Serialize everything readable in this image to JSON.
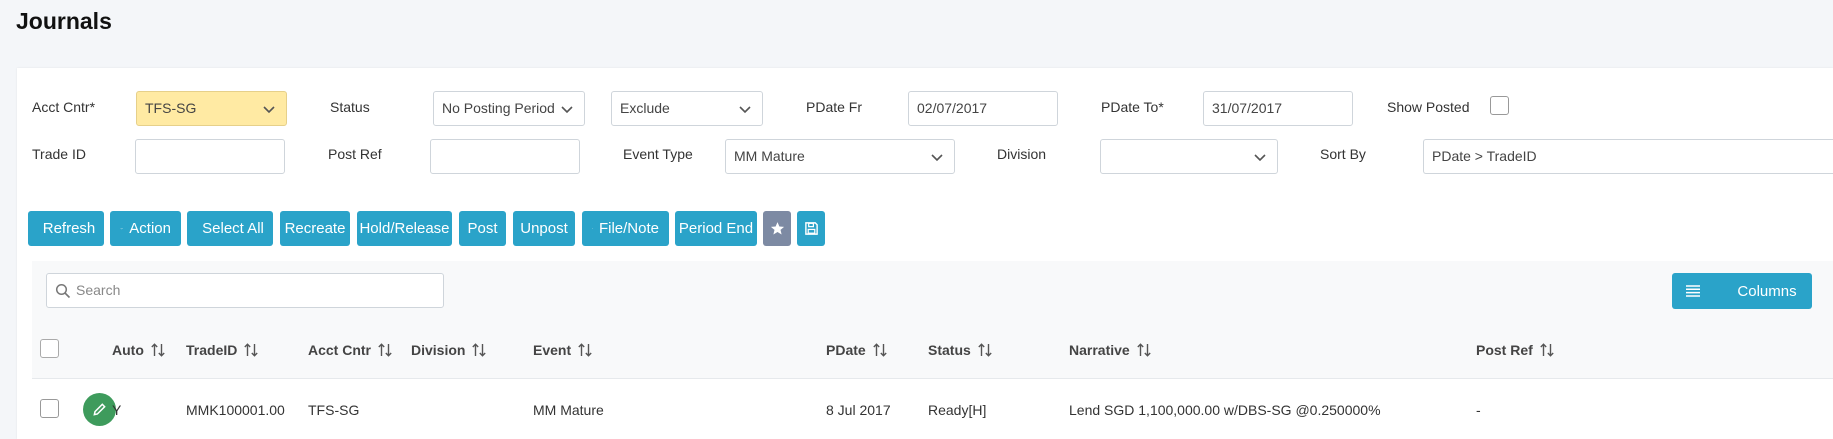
{
  "page": {
    "title": "Journals"
  },
  "filters": {
    "acct_cntr": {
      "label": "Acct Cntr*",
      "value": "TFS-SG"
    },
    "status": {
      "label": "Status",
      "value": "No Posting Period"
    },
    "exclude": {
      "value": "Exclude"
    },
    "pdate_fr": {
      "label": "PDate Fr",
      "value": "02/07/2017"
    },
    "pdate_to": {
      "label": "PDate To*",
      "value": "31/07/2017"
    },
    "show_posted": {
      "label": "Show Posted",
      "checked": false
    },
    "trade_id": {
      "label": "Trade ID",
      "value": ""
    },
    "post_ref": {
      "label": "Post Ref",
      "value": ""
    },
    "event_type": {
      "label": "Event Type",
      "value": "MM Mature"
    },
    "division": {
      "label": "Division",
      "value": ""
    },
    "sort_by": {
      "label": "Sort By",
      "value": "PDate > TradeID"
    }
  },
  "toolbar": {
    "refresh": "Refresh",
    "action": "Action",
    "select_all": "Select All",
    "recreate": "Recreate",
    "hold_release": "Hold/Release",
    "post": "Post",
    "unpost": "Unpost",
    "file_note": "File/Note",
    "period_end": "Period End"
  },
  "table": {
    "search_placeholder": "Search",
    "columns_label": "Columns",
    "headers": {
      "auto": "Auto",
      "trade_id": "TradeID",
      "acct_cntr": "Acct Cntr",
      "division": "Division",
      "event": "Event",
      "pdate": "PDate",
      "status": "Status",
      "narrative": "Narrative",
      "post_ref": "Post Ref"
    },
    "rows": [
      {
        "auto": "Y",
        "trade_id": "MMK100001.00",
        "acct_cntr": "TFS-SG",
        "division": "",
        "event": "MM Mature",
        "pdate": "8 Jul 2017",
        "status": "Ready[H]",
        "narrative": "Lend SGD 1,100,000.00 w/DBS-SG @0.250000%",
        "post_ref": "-"
      }
    ]
  },
  "colors": {
    "accent": "#2aa3c9",
    "grey_button": "#7d8aa3",
    "edit_green": "#3e9b5c",
    "highlight": "#ffeaa3"
  }
}
